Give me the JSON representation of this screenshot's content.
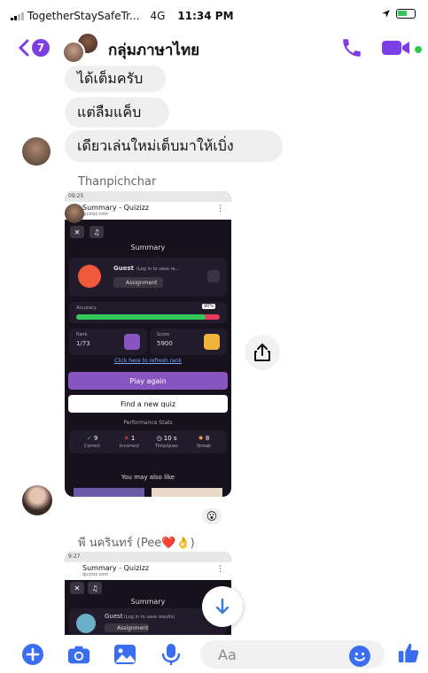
{
  "status_bar": {
    "carrier": "TogetherStaySafeTr...",
    "network": "4G",
    "time": "11:34 PM"
  },
  "header": {
    "back_badge": "7",
    "title": "กลุ่มภาษาไทย",
    "accent_color": "#7b3fe4"
  },
  "messages": [
    {
      "text": "ได้เต็มครับ"
    },
    {
      "text": "แต่ลืมแค็บ"
    },
    {
      "text": "เดียวเล่นใหม่เต็บมาให้เบิ่ง"
    }
  ],
  "shared_screenshots": [
    {
      "sender": "Thanpichchar",
      "clock": "09:25",
      "page_title": "Summary - Quizizz",
      "page_host": "quizizz.com",
      "summary_heading": "Summary",
      "user_name": "Guest",
      "login_hint": "(Log in to save re...",
      "assignment": "Assignment",
      "accuracy_label": "Accuracy",
      "accuracy_value": "90%",
      "accuracy_fraction": 0.9,
      "rank_label": "Rank",
      "rank_value": "1/73",
      "score_label": "Score",
      "score_value": "5900",
      "refresh_link": "Click here to refresh rank",
      "play_again": "Play again",
      "find_quiz": "Find a new quiz",
      "perf_heading": "Performance Stats",
      "stats": [
        {
          "value": "9",
          "label": "Correct",
          "color": "#34c759"
        },
        {
          "value": "1",
          "label": "Incorrect",
          "color": "#ff4d4d"
        },
        {
          "value": "10 s",
          "label": "Time/ques",
          "color": "#dddddd"
        },
        {
          "value": "8",
          "label": "Streak",
          "color": "#f0a23a"
        }
      ],
      "also_like": "You may also like"
    },
    {
      "sender": "พี นครินทร์ (Pee❤️👌)",
      "clock": "9:27",
      "page_title": "Summary - Quizizz",
      "page_host": "quizizz.com",
      "summary_heading": "Summary",
      "user_name": "Guest",
      "login_hint": "(Log in to save results)",
      "assignment": "Assignment"
    }
  ],
  "reaction": "😮",
  "composer": {
    "placeholder": "Aa"
  },
  "icons": [
    "back-chevron-icon",
    "phone-icon",
    "video-camera-icon",
    "share-icon",
    "arrow-down-icon",
    "plus-circle-icon",
    "camera-icon",
    "gallery-icon",
    "microphone-icon",
    "smiley-icon",
    "thumbs-up-icon"
  ]
}
